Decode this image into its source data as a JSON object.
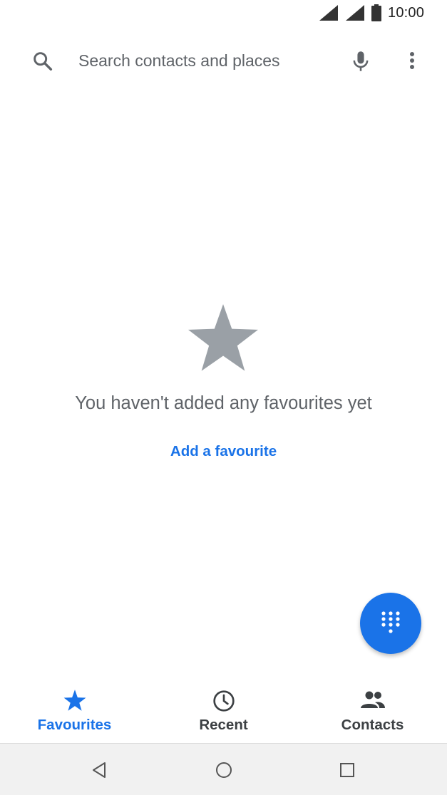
{
  "status_bar": {
    "time": "10:00",
    "icons": [
      "signal-icon",
      "signal-icon",
      "battery-icon"
    ]
  },
  "search": {
    "placeholder": "Search contacts and places",
    "value": "",
    "icons": [
      "search-icon",
      "mic-icon",
      "more-vert-icon"
    ]
  },
  "empty_state": {
    "icon": "star-icon",
    "message": "You haven't added any favourites yet",
    "action_label": "Add a favourite"
  },
  "fab": {
    "icon": "dialpad-icon"
  },
  "bottom_nav": {
    "tabs": [
      {
        "label": "Favourites",
        "icon": "star-icon",
        "selected": true
      },
      {
        "label": "Recent",
        "icon": "clock-icon",
        "selected": false
      },
      {
        "label": "Contacts",
        "icon": "people-icon",
        "selected": false
      }
    ]
  },
  "system_nav": {
    "icons": [
      "back-icon",
      "home-icon",
      "recents-icon"
    ]
  },
  "colors": {
    "accent": "#1a73e8",
    "icon_grey": "#9aa0a6",
    "text_grey": "#5f6368",
    "system_nav_bg": "#f1f1f1"
  }
}
